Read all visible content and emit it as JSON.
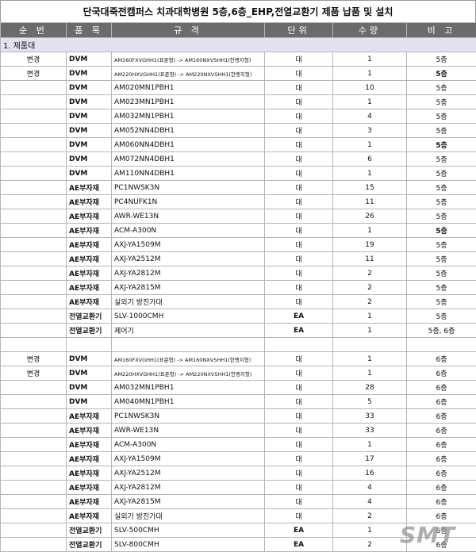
{
  "title": "단국대죽전캠퍼스 치과대학병원 5층,6층_EHP,전열교환기 제품 납품 및 설치",
  "headers": [
    "순 번",
    "품 목",
    "규 격",
    "단위",
    "수량",
    "비 고"
  ],
  "section": "1. 제품대",
  "rows": [
    {
      "no": "변경",
      "item": "DVM",
      "spec": "AM160FXVGHH1(표준형) -> AM160NXVSHH1(한랭지형)",
      "small": true,
      "unit": "대",
      "qty": "1",
      "note": "5층",
      "note_bold": false
    },
    {
      "no": "변경",
      "item": "DVM",
      "spec": "AM220HXVGHH1(표준형) -> AM220NXVSHH1(한랭지형)",
      "small": true,
      "unit": "대",
      "qty": "1",
      "note": "5층",
      "note_bold": true
    },
    {
      "no": "",
      "item": "DVM",
      "spec": "AM020MN1PBH1",
      "small": false,
      "unit": "대",
      "qty": "10",
      "note": "5층",
      "note_bold": false
    },
    {
      "no": "",
      "item": "DVM",
      "spec": "AM023MN1PBH1",
      "small": false,
      "unit": "대",
      "qty": "1",
      "note": "5층",
      "note_bold": false
    },
    {
      "no": "",
      "item": "DVM",
      "spec": "AM032MN1PBH1",
      "small": false,
      "unit": "대",
      "qty": "4",
      "note": "5층",
      "note_bold": false
    },
    {
      "no": "",
      "item": "DVM",
      "spec": "AM052NN4DBH1",
      "small": false,
      "unit": "대",
      "qty": "3",
      "note": "5층",
      "note_bold": false
    },
    {
      "no": "",
      "item": "DVM",
      "spec": "AM060NN4DBH1",
      "small": false,
      "unit": "대",
      "qty": "1",
      "note": "5층",
      "note_bold": true
    },
    {
      "no": "",
      "item": "DVM",
      "spec": "AM072NN4DBH1",
      "small": false,
      "unit": "대",
      "qty": "6",
      "note": "5층",
      "note_bold": false
    },
    {
      "no": "",
      "item": "DVM",
      "spec": "AM110NN4DBH1",
      "small": false,
      "unit": "대",
      "qty": "1",
      "note": "5층",
      "note_bold": false
    },
    {
      "no": "",
      "item": "AE부자재",
      "spec": "PC1NWSK3N",
      "small": false,
      "unit": "대",
      "qty": "15",
      "note": "5층",
      "note_bold": false
    },
    {
      "no": "",
      "item": "AE부자재",
      "spec": "PC4NUFK1N",
      "small": false,
      "unit": "대",
      "qty": "11",
      "note": "5층",
      "note_bold": false
    },
    {
      "no": "",
      "item": "AE부자재",
      "spec": "AWR-WE13N",
      "small": false,
      "unit": "대",
      "qty": "26",
      "note": "5층",
      "note_bold": false
    },
    {
      "no": "",
      "item": "AE부자재",
      "spec": "ACM-A300N",
      "small": false,
      "unit": "대",
      "qty": "1",
      "note": "5층",
      "note_bold": true
    },
    {
      "no": "",
      "item": "AE부자재",
      "spec": "AXJ-YA1509M",
      "small": false,
      "unit": "대",
      "qty": "19",
      "note": "5층",
      "note_bold": false
    },
    {
      "no": "",
      "item": "AE부자재",
      "spec": "AXJ-YA2512M",
      "small": false,
      "unit": "대",
      "qty": "11",
      "note": "5층",
      "note_bold": false
    },
    {
      "no": "",
      "item": "AE부자재",
      "spec": "AXJ-YA2812M",
      "small": false,
      "unit": "대",
      "qty": "2",
      "note": "5층",
      "note_bold": false
    },
    {
      "no": "",
      "item": "AE부자재",
      "spec": "AXJ-YA2815M",
      "small": false,
      "unit": "대",
      "qty": "2",
      "note": "5층",
      "note_bold": false
    },
    {
      "no": "",
      "item": "AE부자재",
      "spec": "실외기 방진가대",
      "small": false,
      "unit": "대",
      "qty": "2",
      "note": "5층",
      "note_bold": false
    },
    {
      "no": "",
      "item": "전열교환기",
      "spec": "SLV-1000CMH",
      "small": false,
      "unit": "EA",
      "qty": "1",
      "note": "5층",
      "note_bold": false
    },
    {
      "no": "",
      "item": "전열교환기",
      "spec": "제어기",
      "small": false,
      "unit": "EA",
      "qty": "1",
      "note": "5층, 6층",
      "note_bold": false
    },
    {
      "blank": true
    },
    {
      "no": "변경",
      "item": "DVM",
      "spec": "AM160FXVGHH1(표준형) -> AM160NXVSHH1(한랭지형)",
      "small": true,
      "unit": "대",
      "qty": "1",
      "note": "6층",
      "note_bold": false
    },
    {
      "no": "변경",
      "item": "DVM",
      "spec": "AM220HXVGHH1(표준형) -> AM220NXVSHH1(한랭지형)",
      "small": true,
      "unit": "대",
      "qty": "1",
      "note": "6층",
      "note_bold": false
    },
    {
      "no": "",
      "item": "DVM",
      "spec": "AM032MN1PBH1",
      "small": false,
      "unit": "대",
      "qty": "28",
      "note": "6층",
      "note_bold": false
    },
    {
      "no": "",
      "item": "DVM",
      "spec": "AM040MN1PBH1",
      "small": false,
      "unit": "대",
      "qty": "5",
      "note": "6층",
      "note_bold": false
    },
    {
      "no": "",
      "item": "AE부자재",
      "spec": "PC1NWSK3N",
      "small": false,
      "unit": "대",
      "qty": "33",
      "note": "6층",
      "note_bold": false
    },
    {
      "no": "",
      "item": "AE부자재",
      "spec": "AWR-WE13N",
      "small": false,
      "unit": "대",
      "qty": "33",
      "note": "6층",
      "note_bold": false
    },
    {
      "no": "",
      "item": "AE부자재",
      "spec": "ACM-A300N",
      "small": false,
      "unit": "대",
      "qty": "1",
      "note": "6층",
      "note_bold": false
    },
    {
      "no": "",
      "item": "AE부자재",
      "spec": "AXJ-YA1509M",
      "small": false,
      "unit": "대",
      "qty": "17",
      "note": "6층",
      "note_bold": false
    },
    {
      "no": "",
      "item": "AE부자재",
      "spec": "AXJ-YA2512M",
      "small": false,
      "unit": "대",
      "qty": "16",
      "note": "6층",
      "note_bold": false
    },
    {
      "no": "",
      "item": "AE부자재",
      "spec": "AXJ-YA2812M",
      "small": false,
      "unit": "대",
      "qty": "4",
      "note": "6층",
      "note_bold": false
    },
    {
      "no": "",
      "item": "AE부자재",
      "spec": "AXJ-YA2815M",
      "small": false,
      "unit": "대",
      "qty": "4",
      "note": "6층",
      "note_bold": false
    },
    {
      "no": "",
      "item": "AE부자재",
      "spec": "실외기 방진가대",
      "small": false,
      "unit": "대",
      "qty": "2",
      "note": "6층",
      "note_bold": false
    },
    {
      "no": "",
      "item": "전열교환기",
      "spec": "SLV-500CMH",
      "small": false,
      "unit": "EA",
      "qty": "1",
      "note": "6층",
      "note_bold": false
    },
    {
      "no": "",
      "item": "전열교환기",
      "spec": "SLV-800CMH",
      "small": false,
      "unit": "EA",
      "qty": "2",
      "note": "6층",
      "note_bold": false
    }
  ],
  "watermark": "SMT"
}
